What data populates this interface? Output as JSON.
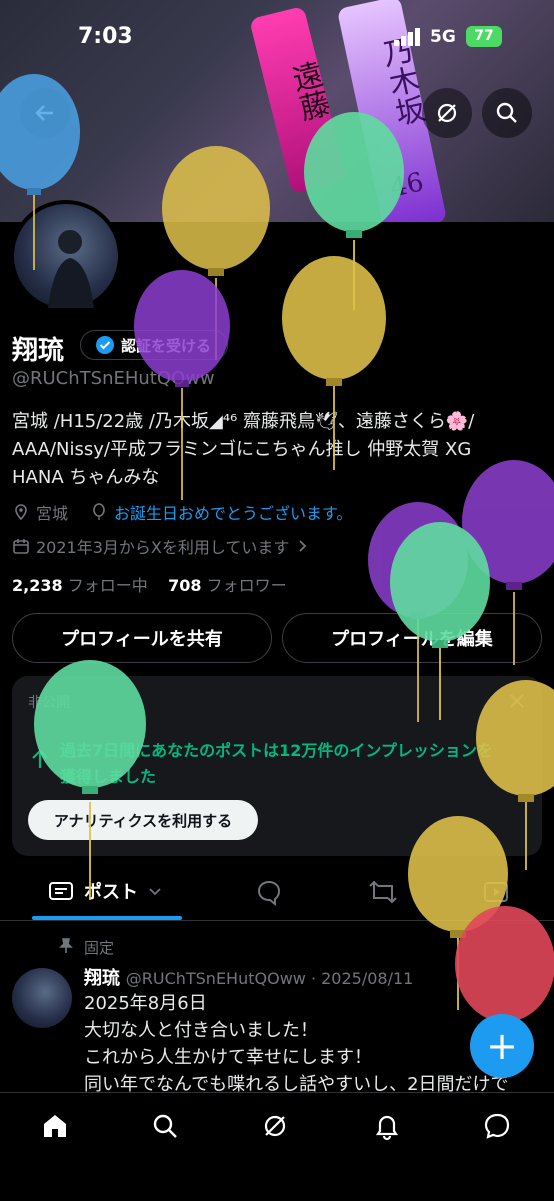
{
  "status_bar": {
    "time": "7:03",
    "network": "5G",
    "battery": "77"
  },
  "banner": {
    "stick_left_text": "遠藤",
    "stick_right_text": "乃木坂",
    "stick_right_number": "46"
  },
  "profile": {
    "name": "翔琉",
    "verify_label": "認証を受ける",
    "handle": "@RUChTSnEHutQOww",
    "bio_lines": [
      "宮城 /H15/22歳 /乃木坂◢⁴⁶ 齋藤飛鳥🕊、遠藤さくら🌸/",
      "AAA/Nissy/平成フラミンゴにこちゃん推し 仲野太賀 XG",
      "HANA ちゃんみな"
    ],
    "location": "宮城",
    "birthday": "お誕生日おめでとうございます。",
    "joined": "2021年3月からXを利用しています",
    "following_count": "2,238",
    "following_label": "フォロー中",
    "followers_count": "708",
    "followers_label": "フォロワー"
  },
  "actions": {
    "share": "プロフィールを共有",
    "edit": "プロフィールを編集"
  },
  "analytics_card": {
    "badge": "非公開",
    "message_line1": "過去7日間にあなたのポストは12万件のインプレッションを",
    "message_line2": "獲得しました",
    "button": "アナリティクスを利用する"
  },
  "tabs": {
    "posts": "ポスト"
  },
  "pinned_post": {
    "pinned_label": "固定",
    "author": "翔琉",
    "handle_date": "@RUChTSnEHutQOww · 2025/08/11",
    "lines": [
      "2025年8月6日",
      "大切な人と付き合いました！",
      "これから人生かけて幸せにします！",
      "同い年でなんでも喋れるし話やすいし、2日間だけで"
    ]
  },
  "fab": {
    "label": "+"
  },
  "colors": {
    "accent": "#1d9bf0",
    "background": "#000000",
    "secondary_text": "#71767b",
    "balloon_blue": "#4aa3e6",
    "balloon_yellow": "#e0c24a",
    "balloon_purple": "#8e3fd0",
    "balloon_green": "#5fdca0",
    "balloon_red": "#e0475a"
  },
  "icons": [
    "back-arrow-icon",
    "grok-icon",
    "search-icon",
    "verified-icon",
    "location-icon",
    "balloon-icon",
    "calendar-icon",
    "chevron-right-icon",
    "close-icon",
    "arrow-up-icon",
    "posts-icon",
    "chevron-down-icon",
    "reply-icon",
    "repost-icon",
    "media-icon",
    "pin-icon",
    "home-icon",
    "notifications-icon",
    "messages-icon"
  ]
}
